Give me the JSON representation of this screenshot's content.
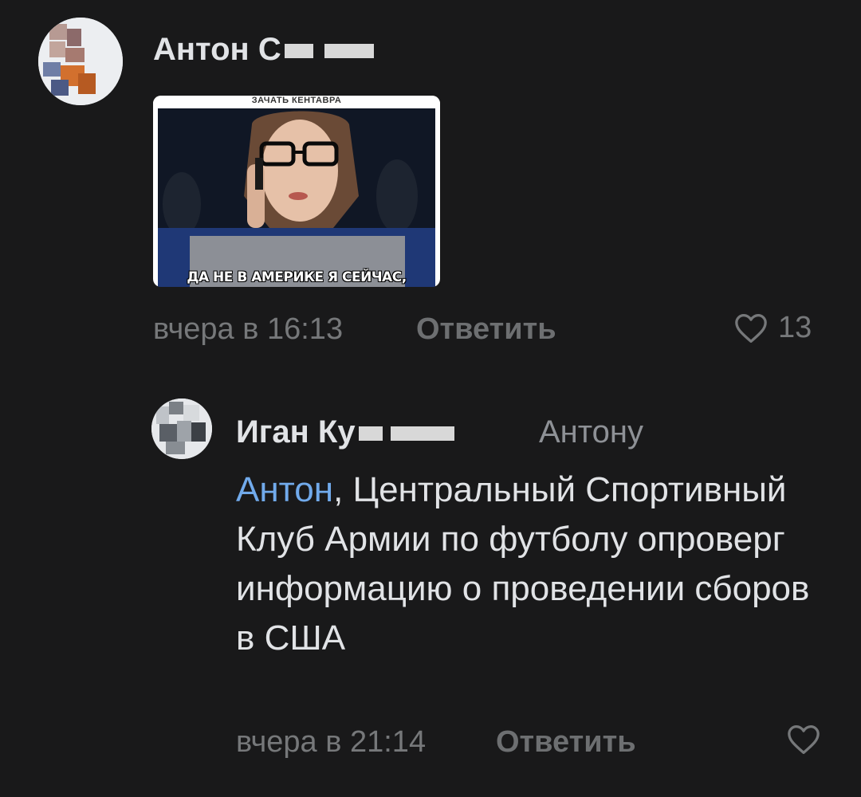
{
  "comments": [
    {
      "author": "Антон С",
      "image": {
        "top_text": "ЗАЧАТЬ КЕНТАВРА",
        "caption": "ДА НЕ В АМЕРИКЕ Я СЕЙЧАС,"
      },
      "time": "вчера в 16:13",
      "reply_label": "Ответить",
      "likes": "13"
    },
    {
      "author": "Иган Ку",
      "reply_to": "Антону",
      "mention": "Антон",
      "text": ", Центральный Спортивный Клуб Армии по футболу опроверг информацию о проведении сборов в США",
      "time": "вчера в 21:14",
      "reply_label": "Ответить"
    }
  ],
  "colors": {
    "background": "#19191a",
    "text": "#e1e3e6",
    "secondary": "#76787a",
    "link": "#71aaeb"
  },
  "icons": {
    "like": "heart-outline-icon"
  }
}
